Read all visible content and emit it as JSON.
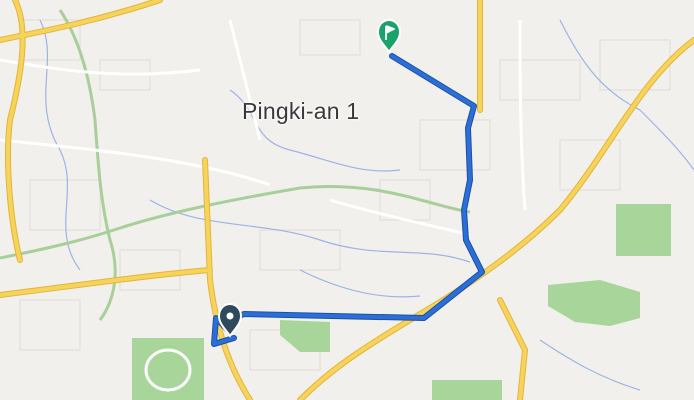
{
  "map": {
    "place_label": "Pingki-an 1",
    "colors": {
      "background": "#f2f0ec",
      "route": "#2a6fd6",
      "route_casing": "#1d4fa8",
      "major_road": "#f6d35b",
      "major_road_casing": "#e2b53b",
      "minor_road": "#ffffff",
      "rail": "#a8cf9a",
      "water": "#9cb3e6",
      "park": "#a8d69a",
      "start_marker": "#2f4a5a",
      "end_marker": "#18a36b"
    },
    "markers": {
      "start": {
        "icon": "location-pin-icon"
      },
      "end": {
        "icon": "destination-flag-pin-icon"
      }
    }
  }
}
